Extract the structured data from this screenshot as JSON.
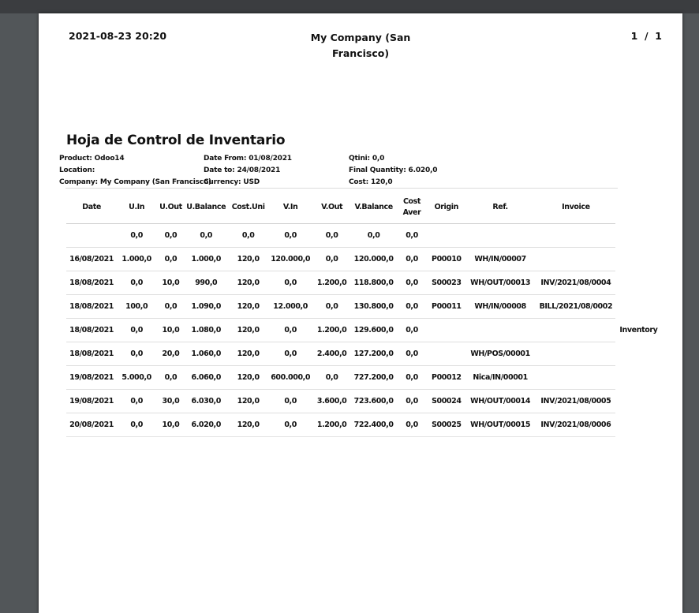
{
  "header": {
    "datetime": "2021-08-23 20:20",
    "company_line1": "My Company (San",
    "company_line2": "Francisco)",
    "page_current": "1",
    "page_sep": "/",
    "page_total": "1"
  },
  "report": {
    "title": "Hoja de Control de Inventario",
    "product": "Product: Odoo14",
    "location": "Location:",
    "company": "Company: My Company (San Francisco)",
    "date_from": "Date From: 01/08/2021",
    "date_to": "Date to: 24/08/2021",
    "currency": "Currency: USD",
    "qtini": "Qtini: 0,0",
    "final_quantity": "Final Quantity: 6.020,0",
    "cost": "Cost: 120,0"
  },
  "table": {
    "headers": [
      "Date",
      "U.In",
      "U.Out",
      "U.Balance",
      "Cost.Uni",
      "V.In",
      "V.Out",
      "V.Balance",
      "Cost Aver",
      "Origin",
      "Ref.",
      "Invoice",
      ""
    ],
    "rows": [
      [
        "",
        "0,0",
        "0,0",
        "0,0",
        "0,0",
        "0,0",
        "0,0",
        "0,0",
        "0,0",
        "",
        "",
        "",
        ""
      ],
      [
        "16/08/2021",
        "1.000,0",
        "0,0",
        "1.000,0",
        "120,0",
        "120.000,0",
        "0,0",
        "120.000,0",
        "0,0",
        "P00010",
        "WH/IN/00007",
        "",
        ""
      ],
      [
        "18/08/2021",
        "0,0",
        "10,0",
        "990,0",
        "120,0",
        "0,0",
        "1.200,0",
        "118.800,0",
        "0,0",
        "S00023",
        "WH/OUT/00013",
        "INV/2021/08/0004",
        ""
      ],
      [
        "18/08/2021",
        "100,0",
        "0,0",
        "1.090,0",
        "120,0",
        "12.000,0",
        "0,0",
        "130.800,0",
        "0,0",
        "P00011",
        "WH/IN/00008",
        "BILL/2021/08/0002",
        ""
      ],
      [
        "18/08/2021",
        "0,0",
        "10,0",
        "1.080,0",
        "120,0",
        "0,0",
        "1.200,0",
        "129.600,0",
        "0,0",
        "",
        "",
        "",
        "Inventory"
      ],
      [
        "18/08/2021",
        "0,0",
        "20,0",
        "1.060,0",
        "120,0",
        "0,0",
        "2.400,0",
        "127.200,0",
        "0,0",
        "",
        "WH/POS/00001",
        "",
        ""
      ],
      [
        "19/08/2021",
        "5.000,0",
        "0,0",
        "6.060,0",
        "120,0",
        "600.000,0",
        "0,0",
        "727.200,0",
        "0,0",
        "P00012",
        "Nica/IN/00001",
        "",
        ""
      ],
      [
        "19/08/2021",
        "0,0",
        "30,0",
        "6.030,0",
        "120,0",
        "0,0",
        "3.600,0",
        "723.600,0",
        "0,0",
        "S00024",
        "WH/OUT/00014",
        "INV/2021/08/0005",
        ""
      ],
      [
        "20/08/2021",
        "0,0",
        "10,0",
        "6.020,0",
        "120,0",
        "0,0",
        "1.200,0",
        "722.400,0",
        "0,0",
        "S00025",
        "WH/OUT/00015",
        "INV/2021/08/0006",
        ""
      ]
    ]
  }
}
